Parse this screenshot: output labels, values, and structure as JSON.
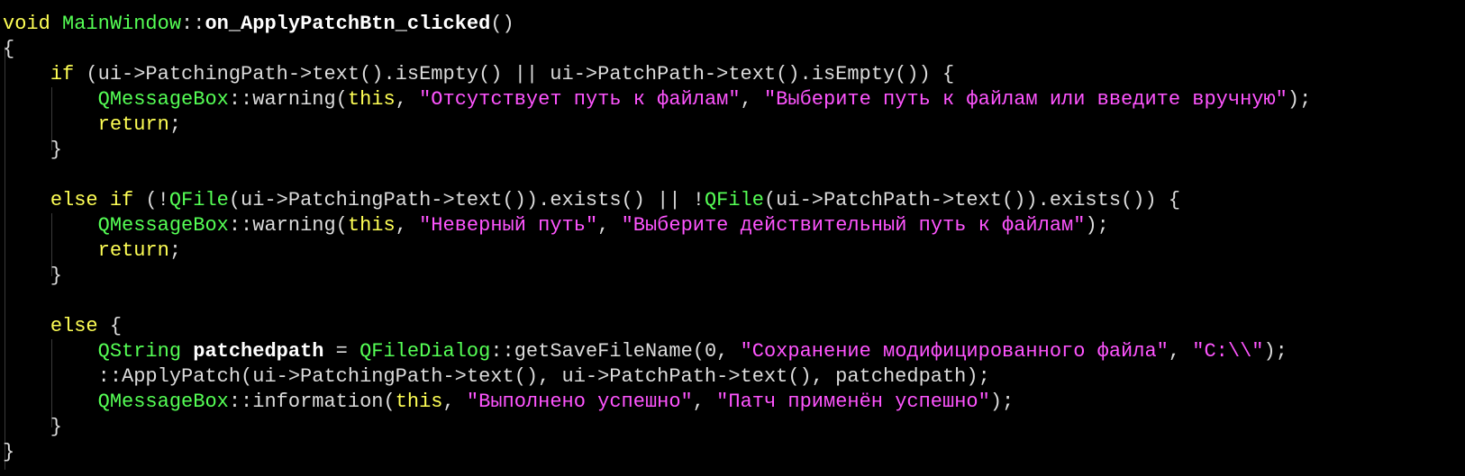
{
  "editor": {
    "colors": {
      "background": "#000000",
      "keyword": "#ffff55",
      "type": "#55ff55",
      "string": "#ff55ff",
      "default": "#dcdcdc"
    },
    "lines": [
      [
        {
          "c": "kw",
          "t": "void"
        },
        {
          "c": "plain",
          "t": " "
        },
        {
          "c": "type",
          "t": "MainWindow"
        },
        {
          "c": "plain",
          "t": "::"
        },
        {
          "c": "bold",
          "t": "on_ApplyPatchBtn_clicked"
        },
        {
          "c": "plain",
          "t": "()"
        }
      ],
      [
        {
          "c": "plain",
          "t": "{"
        }
      ],
      [
        {
          "c": "plain",
          "t": "    "
        },
        {
          "c": "kw",
          "t": "if"
        },
        {
          "c": "plain",
          "t": " (ui->PatchingPath->text().isEmpty() || ui->PatchPath->text().isEmpty()) {"
        }
      ],
      [
        {
          "c": "plain",
          "t": "        "
        },
        {
          "c": "type",
          "t": "QMessageBox"
        },
        {
          "c": "plain",
          "t": "::warning("
        },
        {
          "c": "kw",
          "t": "this"
        },
        {
          "c": "plain",
          "t": ", "
        },
        {
          "c": "str",
          "t": "\"Отсутствует путь к файлам\""
        },
        {
          "c": "plain",
          "t": ", "
        },
        {
          "c": "str",
          "t": "\"Выберите путь к файлам или введите вручную\""
        },
        {
          "c": "plain",
          "t": ");"
        }
      ],
      [
        {
          "c": "plain",
          "t": "        "
        },
        {
          "c": "kw",
          "t": "return"
        },
        {
          "c": "plain",
          "t": ";"
        }
      ],
      [
        {
          "c": "plain",
          "t": "    }"
        }
      ],
      [
        {
          "c": "plain",
          "t": ""
        }
      ],
      [
        {
          "c": "plain",
          "t": "    "
        },
        {
          "c": "kw",
          "t": "else"
        },
        {
          "c": "plain",
          "t": " "
        },
        {
          "c": "kw",
          "t": "if"
        },
        {
          "c": "plain",
          "t": " (!"
        },
        {
          "c": "type",
          "t": "QFile"
        },
        {
          "c": "plain",
          "t": "(ui->PatchingPath->text()).exists() || !"
        },
        {
          "c": "type",
          "t": "QFile"
        },
        {
          "c": "plain",
          "t": "(ui->PatchPath->text()).exists()) {"
        }
      ],
      [
        {
          "c": "plain",
          "t": "        "
        },
        {
          "c": "type",
          "t": "QMessageBox"
        },
        {
          "c": "plain",
          "t": "::warning("
        },
        {
          "c": "kw",
          "t": "this"
        },
        {
          "c": "plain",
          "t": ", "
        },
        {
          "c": "str",
          "t": "\"Неверный путь\""
        },
        {
          "c": "plain",
          "t": ", "
        },
        {
          "c": "str",
          "t": "\"Выберите действительный путь к файлам\""
        },
        {
          "c": "plain",
          "t": ");"
        }
      ],
      [
        {
          "c": "plain",
          "t": "        "
        },
        {
          "c": "kw",
          "t": "return"
        },
        {
          "c": "plain",
          "t": ";"
        }
      ],
      [
        {
          "c": "plain",
          "t": "    }"
        }
      ],
      [
        {
          "c": "plain",
          "t": ""
        }
      ],
      [
        {
          "c": "plain",
          "t": "    "
        },
        {
          "c": "kw",
          "t": "else"
        },
        {
          "c": "plain",
          "t": " {"
        }
      ],
      [
        {
          "c": "plain",
          "t": "        "
        },
        {
          "c": "type",
          "t": "QString"
        },
        {
          "c": "plain",
          "t": " "
        },
        {
          "c": "bold",
          "t": "patchedpath"
        },
        {
          "c": "plain",
          "t": " = "
        },
        {
          "c": "type",
          "t": "QFileDialog"
        },
        {
          "c": "plain",
          "t": "::getSaveFileName(0, "
        },
        {
          "c": "str",
          "t": "\"Сохранение модифицированного файла\""
        },
        {
          "c": "plain",
          "t": ", "
        },
        {
          "c": "str",
          "t": "\"C:\\\\\""
        },
        {
          "c": "plain",
          "t": ");"
        }
      ],
      [
        {
          "c": "plain",
          "t": "        ::ApplyPatch(ui->PatchingPath->text(), ui->PatchPath->text(), patchedpath);"
        }
      ],
      [
        {
          "c": "plain",
          "t": "        "
        },
        {
          "c": "type",
          "t": "QMessageBox"
        },
        {
          "c": "plain",
          "t": "::information("
        },
        {
          "c": "kw",
          "t": "this"
        },
        {
          "c": "plain",
          "t": ", "
        },
        {
          "c": "str",
          "t": "\"Выполнено успешно\""
        },
        {
          "c": "plain",
          "t": ", "
        },
        {
          "c": "str",
          "t": "\"Патч применён успешно\""
        },
        {
          "c": "plain",
          "t": ");"
        }
      ],
      [
        {
          "c": "plain",
          "t": "    }"
        }
      ],
      [
        {
          "c": "plain",
          "t": "}"
        }
      ]
    ]
  }
}
